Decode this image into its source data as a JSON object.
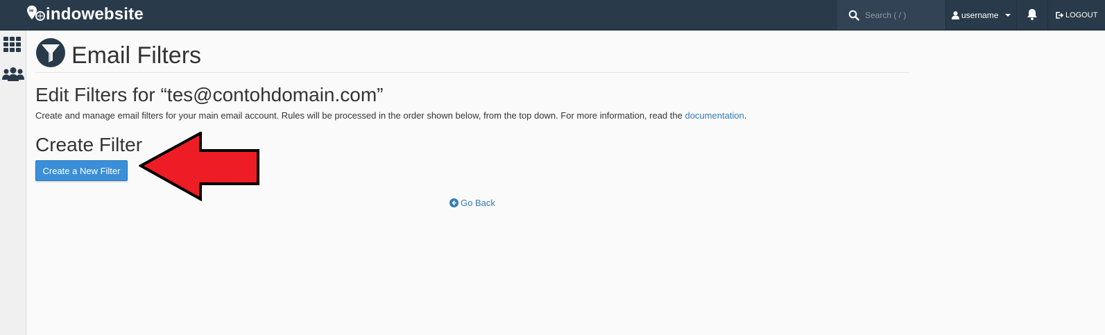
{
  "header": {
    "brand": "indowebsite",
    "search": {
      "placeholder": "Search ( / )",
      "value": ""
    },
    "user": {
      "label": "username"
    },
    "logout_label": "LOGOUT",
    "colors": {
      "bar": "#293a4a",
      "search_bg": "#314355"
    }
  },
  "sidebar": {
    "items": [
      {
        "icon": "grid-icon"
      },
      {
        "icon": "users-icon"
      }
    ]
  },
  "page": {
    "title": "Email Filters",
    "icon": "funnel-icon",
    "edit_title": "Edit Filters for “tes@contohdomain.com”",
    "description_prefix": "Create and manage email filters for your main email account. Rules will be processed in the order shown below, from the top down. For more information, read the ",
    "description_link": "documentation",
    "description_suffix": ".",
    "create_title": "Create Filter",
    "create_button": "Create a New Filter",
    "go_back": "Go Back",
    "colors": {
      "primary_button": "#3a8fd8",
      "link": "#337ab7"
    }
  },
  "annotation": {
    "type": "arrow",
    "color": "#ee1c25",
    "points_to": "create-new-filter-button"
  }
}
